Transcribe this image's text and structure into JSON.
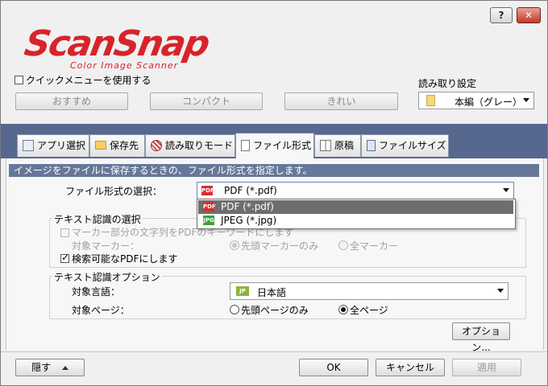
{
  "window": {
    "help_label": "?",
    "close_label": "✕"
  },
  "logo": {
    "brand": "ScanSnap",
    "tagline": "Color Image Scanner",
    "brand_color": "#d8232a"
  },
  "top": {
    "quick_menu_label": "クイックメニューを使用する",
    "quick_menu_checked": false,
    "presets": [
      "おすすめ",
      "コンパクト",
      "きれい"
    ],
    "scan_settings_label": "読み取り設定",
    "scan_settings_value": "本編（グレー）"
  },
  "tabs": [
    {
      "label": "アプリ選択",
      "icon": "app-select-icon"
    },
    {
      "label": "保存先",
      "icon": "folder-icon"
    },
    {
      "label": "読み取りモード",
      "icon": "scan-mode-icon"
    },
    {
      "label": "ファイル形式",
      "icon": "file-icon",
      "active": true
    },
    {
      "label": "原稿",
      "icon": "document-icon"
    },
    {
      "label": "ファイルサイズ",
      "icon": "file-size-icon"
    }
  ],
  "file_format": {
    "description": "イメージをファイルに保存するときの、ファイル形式を指定します。",
    "select_label": "ファイル形式の選択：",
    "selected": "PDF (*.pdf)",
    "options": [
      "PDF (*.pdf)",
      "JPEG (*.jpg)"
    ],
    "option_badges": [
      "PDF",
      "JPG"
    ]
  },
  "text_recognition": {
    "legend": "テキスト認識の選択",
    "marker_keyword_label": "マーカー部分の文字列をPDFのキーワードにします",
    "target_marker_label": "対象マーカー：",
    "marker_options": [
      "先頭マーカーのみ",
      "全マーカー"
    ],
    "searchable_pdf_label": "検索可能なPDFにします",
    "searchable_pdf_checked": true
  },
  "text_options": {
    "legend": "テキスト認識オプション",
    "language_label": "対象言語：",
    "language_badge": "JP",
    "language_value": "日本語",
    "page_label": "対象ページ：",
    "page_options": [
      "先頭ページのみ",
      "全ページ"
    ],
    "page_selected": 1,
    "options_button": "オプション..."
  },
  "footer": {
    "hide_label": "隠す",
    "ok_label": "OK",
    "cancel_label": "キャンセル",
    "apply_label": "適用"
  }
}
